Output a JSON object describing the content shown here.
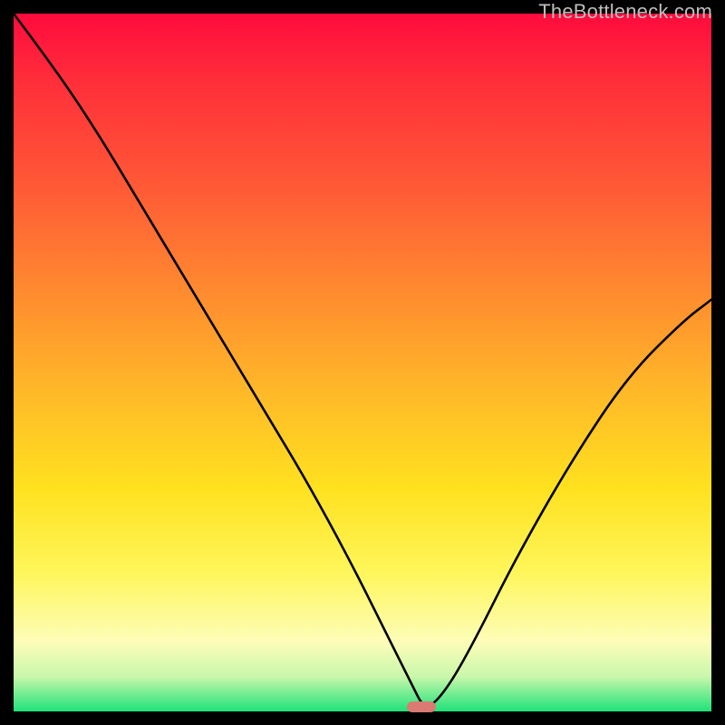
{
  "watermark": "TheBottleneck.com",
  "marker": {
    "x_fraction": 0.585,
    "y_fraction": 0.993,
    "color": "#db7a72"
  },
  "chart_data": {
    "type": "line",
    "title": "",
    "xlabel": "",
    "ylabel": "",
    "xlim": [
      0,
      1
    ],
    "ylim": [
      0,
      1
    ],
    "y_axis_inverted": false,
    "notes": "Axes are unlabeled; background is a vertical color gradient from red (top) through orange/yellow to green (bottom). Line shows a sharp bottleneck-style dip reaching ~0 near x≈0.59.",
    "series": [
      {
        "name": "bottleneck-curve",
        "x": [
          0.0,
          0.06,
          0.12,
          0.18,
          0.24,
          0.3,
          0.36,
          0.42,
          0.48,
          0.53,
          0.57,
          0.59,
          0.62,
          0.66,
          0.72,
          0.8,
          0.88,
          0.96,
          1.0
        ],
        "values": [
          1.0,
          0.92,
          0.83,
          0.73,
          0.63,
          0.53,
          0.43,
          0.33,
          0.22,
          0.12,
          0.04,
          0.0,
          0.03,
          0.1,
          0.22,
          0.36,
          0.48,
          0.56,
          0.59
        ]
      }
    ]
  }
}
